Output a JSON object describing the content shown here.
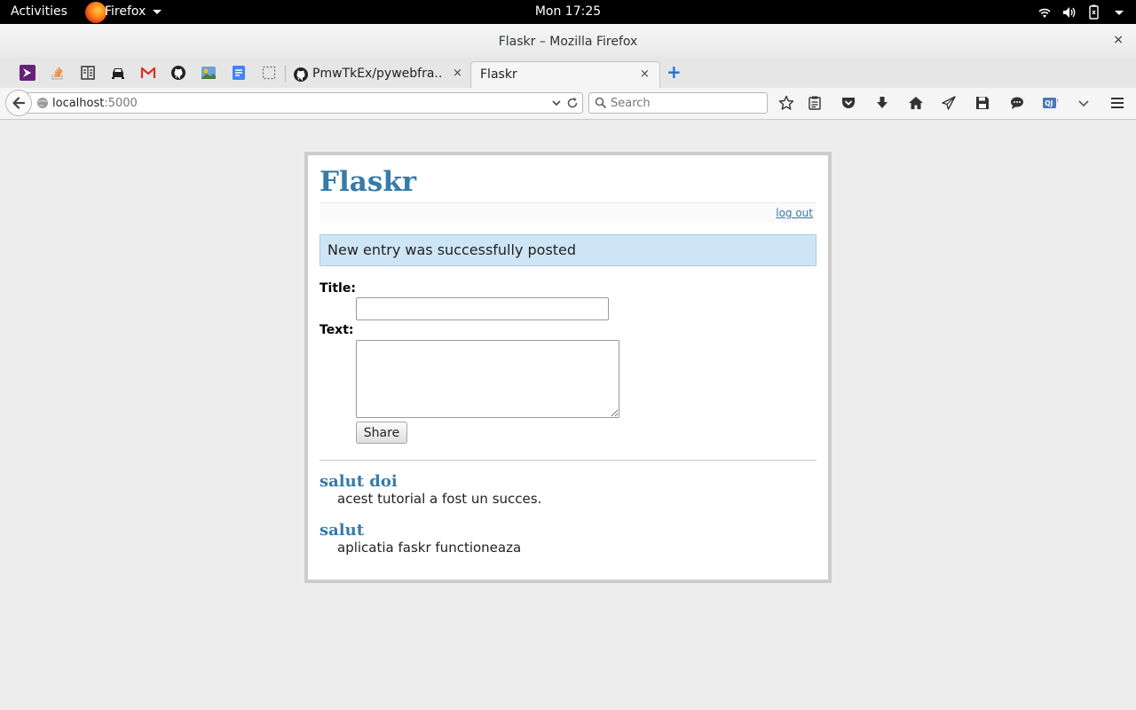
{
  "topbar": {
    "activities": "Activities",
    "app_name": "Firefox",
    "clock": "Mon 17:25"
  },
  "window": {
    "title": "Flaskr – Mozilla Firefox",
    "close_glyph": "×"
  },
  "tabs": [
    {
      "title": "PmwTkEx/pywebfra...",
      "active": false,
      "close_glyph": "×"
    },
    {
      "title": "Flaskr",
      "active": true,
      "close_glyph": "×"
    }
  ],
  "navbar": {
    "url_host": "localhost",
    "url_port": ":5000",
    "search_placeholder": "Search"
  },
  "page": {
    "title": "Flaskr",
    "logout_label": "log out",
    "flash_message": "New entry was successfully posted",
    "form": {
      "title_label": "Title:",
      "title_value": "",
      "text_label": "Text:",
      "text_value": "",
      "share_label": "Share"
    },
    "entries": [
      {
        "title": "salut doi",
        "text": "acest tutorial a fost un succes."
      },
      {
        "title": "salut",
        "text": "aplicatia faskr functioneaza"
      }
    ]
  },
  "colors": {
    "accent": "#377ba8",
    "flash_bg": "#cee5f5",
    "page_border": "#cccccc",
    "background": "#ededed"
  },
  "icons": {
    "pinned_tabs": [
      "visual-studio-icon",
      "stackoverflow-icon",
      "reader-icon",
      "car-icon",
      "gmail-icon",
      "github-icon",
      "image-app-icon",
      "docs-icon",
      "blank-tab-icon"
    ],
    "toolbar": [
      "bookmark-star-icon",
      "reading-list-icon",
      "pocket-icon",
      "download-icon",
      "home-icon",
      "send-icon",
      "save-icon",
      "chat-icon",
      "extension-icon",
      "overflow-chevron-icon",
      "hamburger-menu-icon"
    ]
  }
}
